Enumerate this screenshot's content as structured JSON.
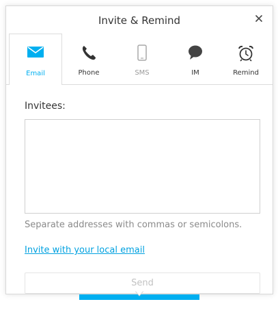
{
  "dialog": {
    "title": "Invite & Remind",
    "close_icon": "close-icon"
  },
  "tabs": [
    {
      "id": "email",
      "label": "Email",
      "icon": "envelope-icon",
      "state": "active"
    },
    {
      "id": "phone",
      "label": "Phone",
      "icon": "phone-icon",
      "state": "normal"
    },
    {
      "id": "sms",
      "label": "SMS",
      "icon": "mobile-icon",
      "state": "disabled"
    },
    {
      "id": "im",
      "label": "IM",
      "icon": "chat-bubble-icon",
      "state": "normal"
    },
    {
      "id": "remind",
      "label": "Remind",
      "icon": "alarm-clock-icon",
      "state": "normal"
    }
  ],
  "form": {
    "invitees_label": "Invitees:",
    "invitees_value": "",
    "hint": "Separate addresses with commas or semicolons.",
    "local_email_link": "Invite with your local email",
    "send_label": "Send"
  },
  "colors": {
    "accent": "#00aff0",
    "link": "#00a1e0",
    "text": "#333333",
    "muted": "#8a8a8a",
    "disabled": "#c2c2c2"
  }
}
